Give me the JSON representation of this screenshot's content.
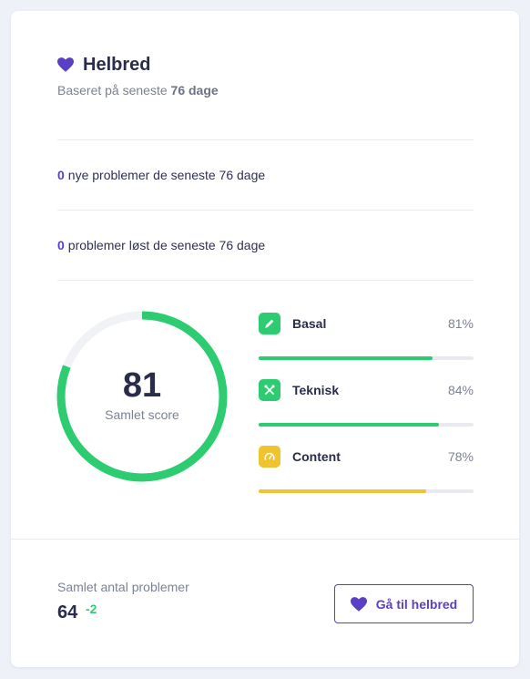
{
  "header": {
    "icon": "heart-icon",
    "title": "Helbred",
    "subtitle_prefix": "Baseret på seneste",
    "subtitle_days": "76 dage"
  },
  "stats": [
    {
      "count": "0",
      "text": "nye problemer de seneste 76 dage"
    },
    {
      "count": "0",
      "text": "problemer løst de seneste 76 dage"
    }
  ],
  "score": {
    "value": 81,
    "label": "Samlet score",
    "color": "#2ecc71",
    "track_color": "#f1f2f5"
  },
  "metrics": [
    {
      "name": "Basal",
      "percent": "81%",
      "value": 81,
      "icon": "pencil-icon",
      "color": "#2ecc71"
    },
    {
      "name": "Teknisk",
      "percent": "84%",
      "value": 84,
      "icon": "tools-icon",
      "color": "#2ecc71"
    },
    {
      "name": "Content",
      "percent": "78%",
      "value": 78,
      "icon": "gauge-icon",
      "color": "#f0c330"
    }
  ],
  "footer": {
    "total_label": "Samlet antal problemer",
    "total_value": "64",
    "total_delta": "-2",
    "button_label": "Gå til helbred"
  },
  "colors": {
    "accent": "#5b3fc4",
    "green": "#2ecc71",
    "yellow": "#f0c330"
  }
}
